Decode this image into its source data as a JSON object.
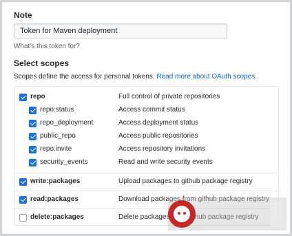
{
  "note": {
    "label": "Note",
    "value": "Token for Maven deployment",
    "hint": "What’s this token for?"
  },
  "scopes": {
    "title": "Select scopes",
    "description": "Scopes define the access for personal tokens. ",
    "link_text": "Read more about OAuth scopes.",
    "groups": [
      {
        "name": "repo",
        "description": "Full control of private repositories",
        "checked": true,
        "children": [
          {
            "name": "repo:status",
            "description": "Access commit status",
            "checked": true
          },
          {
            "name": "repo_deployment",
            "description": "Access deployment status",
            "checked": true
          },
          {
            "name": "public_repo",
            "description": "Access public repositories",
            "checked": true
          },
          {
            "name": "repo:invite",
            "description": "Access repository invitations",
            "checked": true
          },
          {
            "name": "security_events",
            "description": "Read and write security events",
            "checked": true
          }
        ]
      },
      {
        "name": "write:packages",
        "description": "Upload packages to github package registry",
        "checked": true,
        "children": []
      },
      {
        "name": "read:packages",
        "description": "Download packages from github package registry",
        "checked": true,
        "children": []
      },
      {
        "name": "delete:packages",
        "description": "Delete packages from github package registry",
        "checked": false,
        "children": []
      }
    ]
  },
  "colors": {
    "accent": "#1a73e8",
    "link": "#0366d6",
    "border": "#e1e4e8"
  }
}
